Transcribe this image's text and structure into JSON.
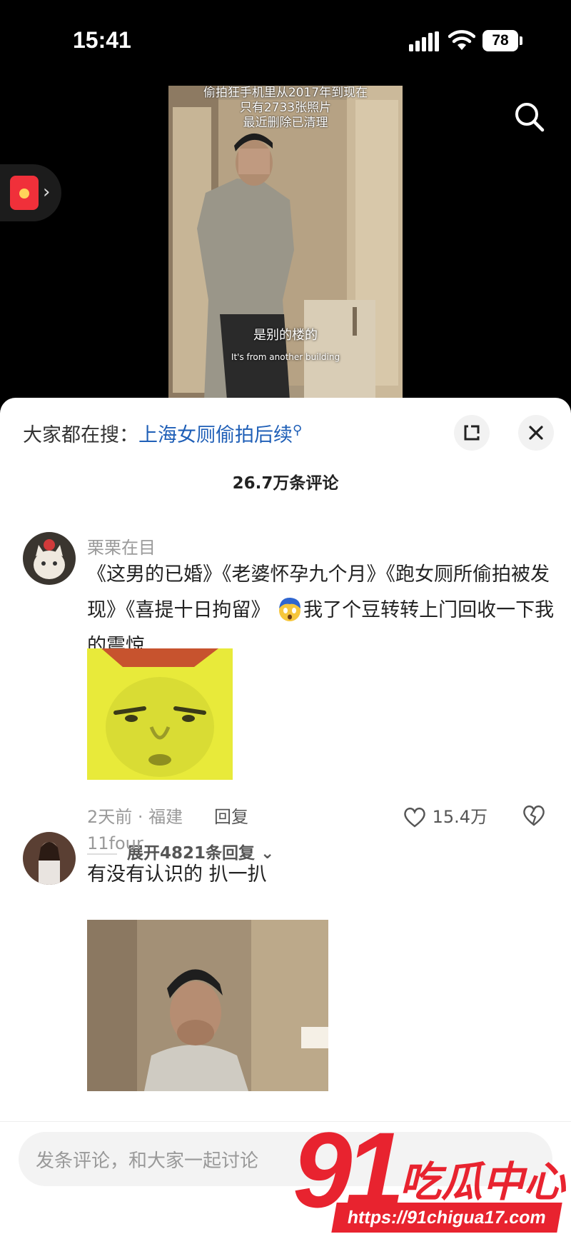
{
  "status_bar": {
    "time": "15:41",
    "battery": "78"
  },
  "video": {
    "overlay_lines": [
      "偷拍狂手机里从2017年到现在",
      "只有2733张照片",
      "最近删除已清理"
    ],
    "caption_cn": "是别的楼的",
    "caption_en": "It's from another building"
  },
  "panel": {
    "search_prefix": "大家都在搜：",
    "search_term": "上海女厕偷拍后续",
    "comment_count": "26.7万条评论"
  },
  "comments": [
    {
      "username": "栗栗在目",
      "text_before_emoji": "《这男的已婚》《老婆怀孕九个月》《跑女厕所偷拍被发现》《喜提十日拘留》",
      "text_after_emoji": "我了个豆转转上门回收一下我的震惊",
      "meta": "2天前 · 福建",
      "reply_label": "回复",
      "likes": "15.4万",
      "expand_replies": "展开4821条回复"
    },
    {
      "username": "11four",
      "text": "有没有认识的 扒一扒"
    }
  ],
  "input": {
    "placeholder": "发条评论，和大家一起讨论"
  },
  "watermark": {
    "brand_number": "91",
    "brand_text": "吃瓜中心",
    "url": "https://91chigua17.com"
  },
  "icons": {
    "signal": "signal-icon",
    "wifi": "wifi-icon",
    "search": "search-icon",
    "red_packet": "red-packet-icon",
    "expand": "expand-icon",
    "close": "close-icon",
    "like": "heart-icon",
    "dislike": "broken-heart-icon",
    "chevron": "chevron-down-icon"
  }
}
